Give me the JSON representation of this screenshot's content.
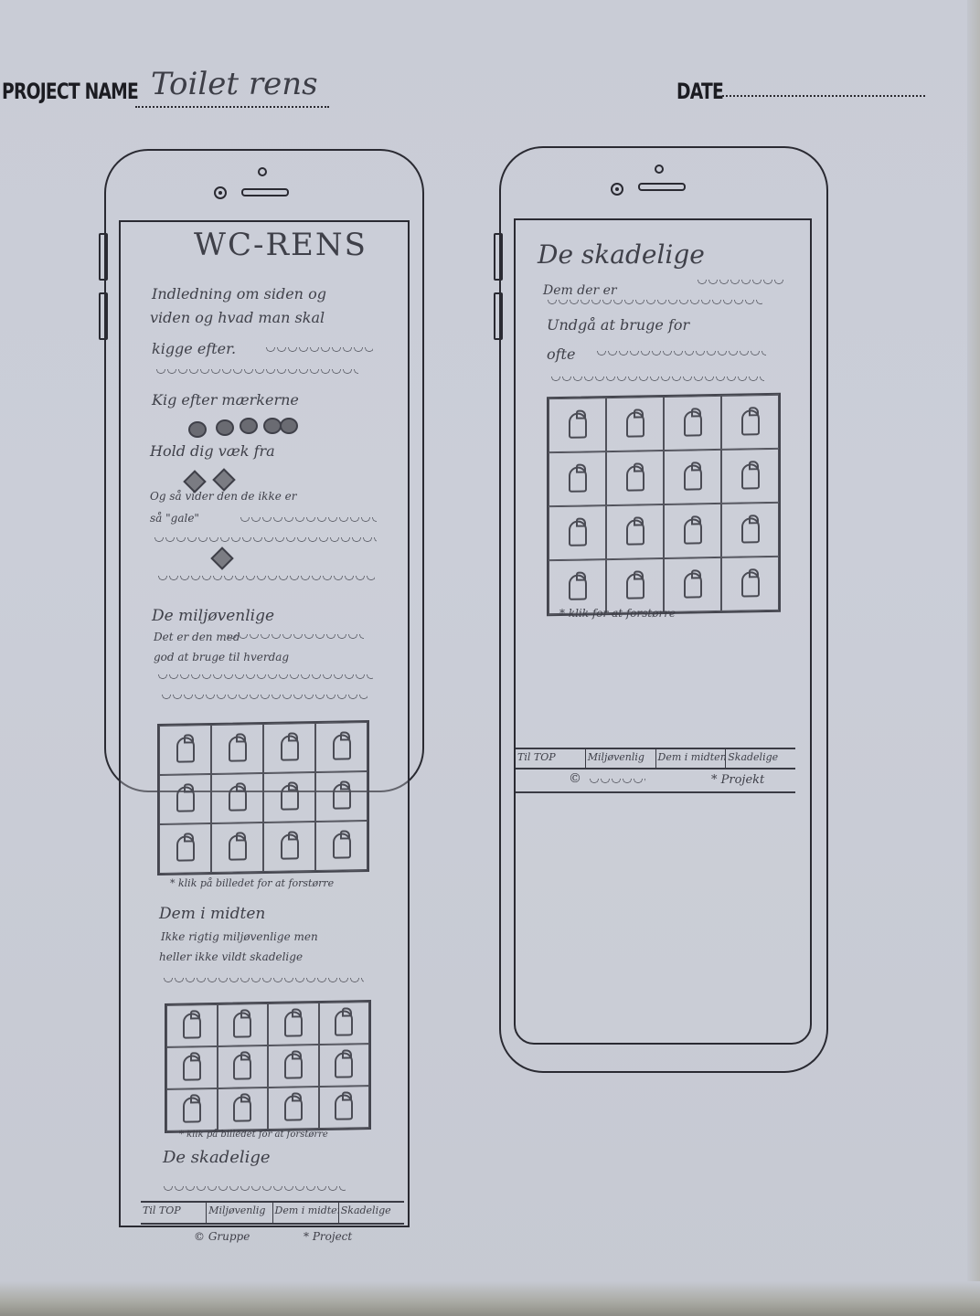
{
  "sheet": {
    "project_name_label": "PROJECT NAME",
    "project_name_value": "Toilet rens",
    "date_label": "DATE"
  },
  "phone1": {
    "title": "WC-RENS",
    "intro": [
      "Indledning om siden og",
      "viden og hvad man skal",
      "kigge efter."
    ],
    "look_for": "Kig efter mærkerne",
    "stay_away": "Hold dig væk fra",
    "also": [
      "Og så vider den de ikke er",
      "så \"gale\""
    ],
    "eco_title": "De miljøvenlige",
    "eco_text": [
      "Det er den med",
      "god at bruge til hverdag"
    ],
    "caption1": "* klik på billedet for at forstørre",
    "middle_title": "Dem i midten",
    "middle_text": [
      "Ikke rigtig miljøvenlige men",
      "heller ikke vildt skadelige"
    ],
    "caption2": "* klik på billedet for at forstørre",
    "harmful_title": "De skadelige",
    "nav": [
      "Til TOP",
      "Miljøvenlig",
      "Dem i midten",
      "Skadelige"
    ],
    "footer_left": "© Gruppe",
    "footer_right": "* Project"
  },
  "phone2": {
    "title": "De skadelige",
    "text": [
      "Dem der er",
      "Undgå at bruge for",
      "ofte"
    ],
    "caption": "* klik for at forstørre",
    "nav": [
      "Til TOP",
      "Miljøvenlig",
      "Dem i midten",
      "Skadelige"
    ],
    "footer_left": "©",
    "footer_right": "* Projekt"
  }
}
